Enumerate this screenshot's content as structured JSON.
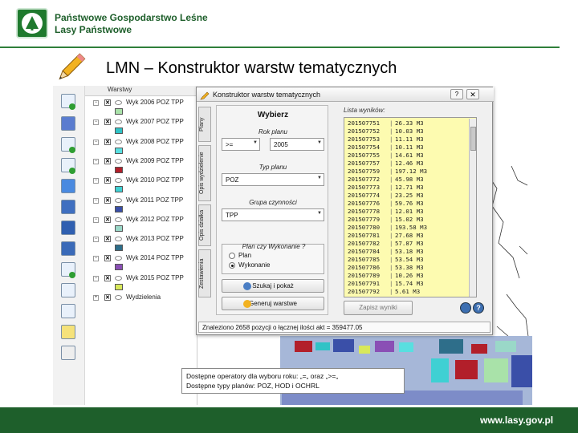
{
  "header": {
    "logo_line1": "Państwowe Gospodarstwo Leśne",
    "logo_line2": "Lasy Państwowe",
    "slide_title": "LMN – Konstruktor warstw tematycznych"
  },
  "colors": {
    "brand_green": "#1e5f2b",
    "results_bg": "#fdfbb0"
  },
  "layers_panel": {
    "title": "Warstwy",
    "items": [
      {
        "label": "Wyk 2006 POZ TPP",
        "swatch": "#a9e2a9"
      },
      {
        "label": "Wyk 2007 POZ TPP",
        "swatch": "#30c3c6"
      },
      {
        "label": "Wyk 2008 POZ TPP",
        "swatch": "#58dfe0"
      },
      {
        "label": "Wyk 2009 POZ TPP",
        "swatch": "#b21f2a"
      },
      {
        "label": "Wyk 2010 POZ TPP",
        "swatch": "#3fd0d3"
      },
      {
        "label": "Wyk 2011 POZ TPP",
        "swatch": "#3a4fa8"
      },
      {
        "label": "Wyk 2012 POZ TPP",
        "swatch": "#9ad8c8"
      },
      {
        "label": "Wyk 2013 POZ TPP",
        "swatch": "#2e6e8a"
      },
      {
        "label": "Wyk 2014 POZ TPP",
        "swatch": "#8a4fb5"
      },
      {
        "label": "Wyk 2015 POZ TPP",
        "swatch": "#d8e85a"
      },
      {
        "label": "Wydzielenia",
        "swatch": ""
      }
    ]
  },
  "dialog": {
    "title": "Konstruktor warstw tematycznych",
    "tabs": [
      "Plany",
      "Opis wydzielenie",
      "Opis działka",
      "Zestawienia"
    ],
    "heading": "Wybierz",
    "rok_label": "Rok planu",
    "operator_value": ">=",
    "year_value": "2005",
    "typ_label": "Typ planu",
    "typ_value": "POZ",
    "grupa_label": "Grupa czynności",
    "grupa_value": "TPP",
    "plan_group_title": "Plan czy Wykonanie ?",
    "radio_plan": "Plan",
    "radio_wykonanie": "Wykonanie",
    "search_button": "Szukaj i pokaż",
    "generate_button": "Generuj warstwe",
    "results_label": "Lista wyników:",
    "save_button": "Zapisz wyniki",
    "status_text": "Znaleziono 2658 pozycji o łącznej ilości akt = 359477.05",
    "results": [
      {
        "id": "201507751",
        "value": "26.33 M3"
      },
      {
        "id": "201507752",
        "value": "10.03 M3"
      },
      {
        "id": "201507753",
        "value": "11.11 M3"
      },
      {
        "id": "201507754",
        "value": "10.11 M3"
      },
      {
        "id": "201507755",
        "value": "14.61 M3"
      },
      {
        "id": "201507757",
        "value": "12.46 M3"
      },
      {
        "id": "201507759",
        "value": "197.12 M3"
      },
      {
        "id": "201507772",
        "value": "45.98 M3"
      },
      {
        "id": "201507773",
        "value": "12.71 M3"
      },
      {
        "id": "201507774",
        "value": "23.25 M3"
      },
      {
        "id": "201507776",
        "value": "59.76 M3"
      },
      {
        "id": "201507778",
        "value": "12.01 M3"
      },
      {
        "id": "201507779",
        "value": "15.02 M3"
      },
      {
        "id": "201507780",
        "value": "193.58 M3"
      },
      {
        "id": "201507781",
        "value": "27.68 M3"
      },
      {
        "id": "201507782",
        "value": "57.87 M3"
      },
      {
        "id": "201507784",
        "value": "53.18 M3"
      },
      {
        "id": "201507785",
        "value": "53.54 M3"
      },
      {
        "id": "201507786",
        "value": "53.38 M3"
      },
      {
        "id": "201507789",
        "value": "10.26 M3"
      },
      {
        "id": "201507791",
        "value": "15.74 M3"
      },
      {
        "id": "201507792",
        "value": "5.61 M3"
      }
    ]
  },
  "note": {
    "line1": "Dostępne operatory dla wyboru roku: „=„ oraz „>=„",
    "line2": "Dostępne typy planów: POZ, HOD i OCHRL"
  },
  "footer": {
    "url": "www.lasy.gov.pl"
  }
}
